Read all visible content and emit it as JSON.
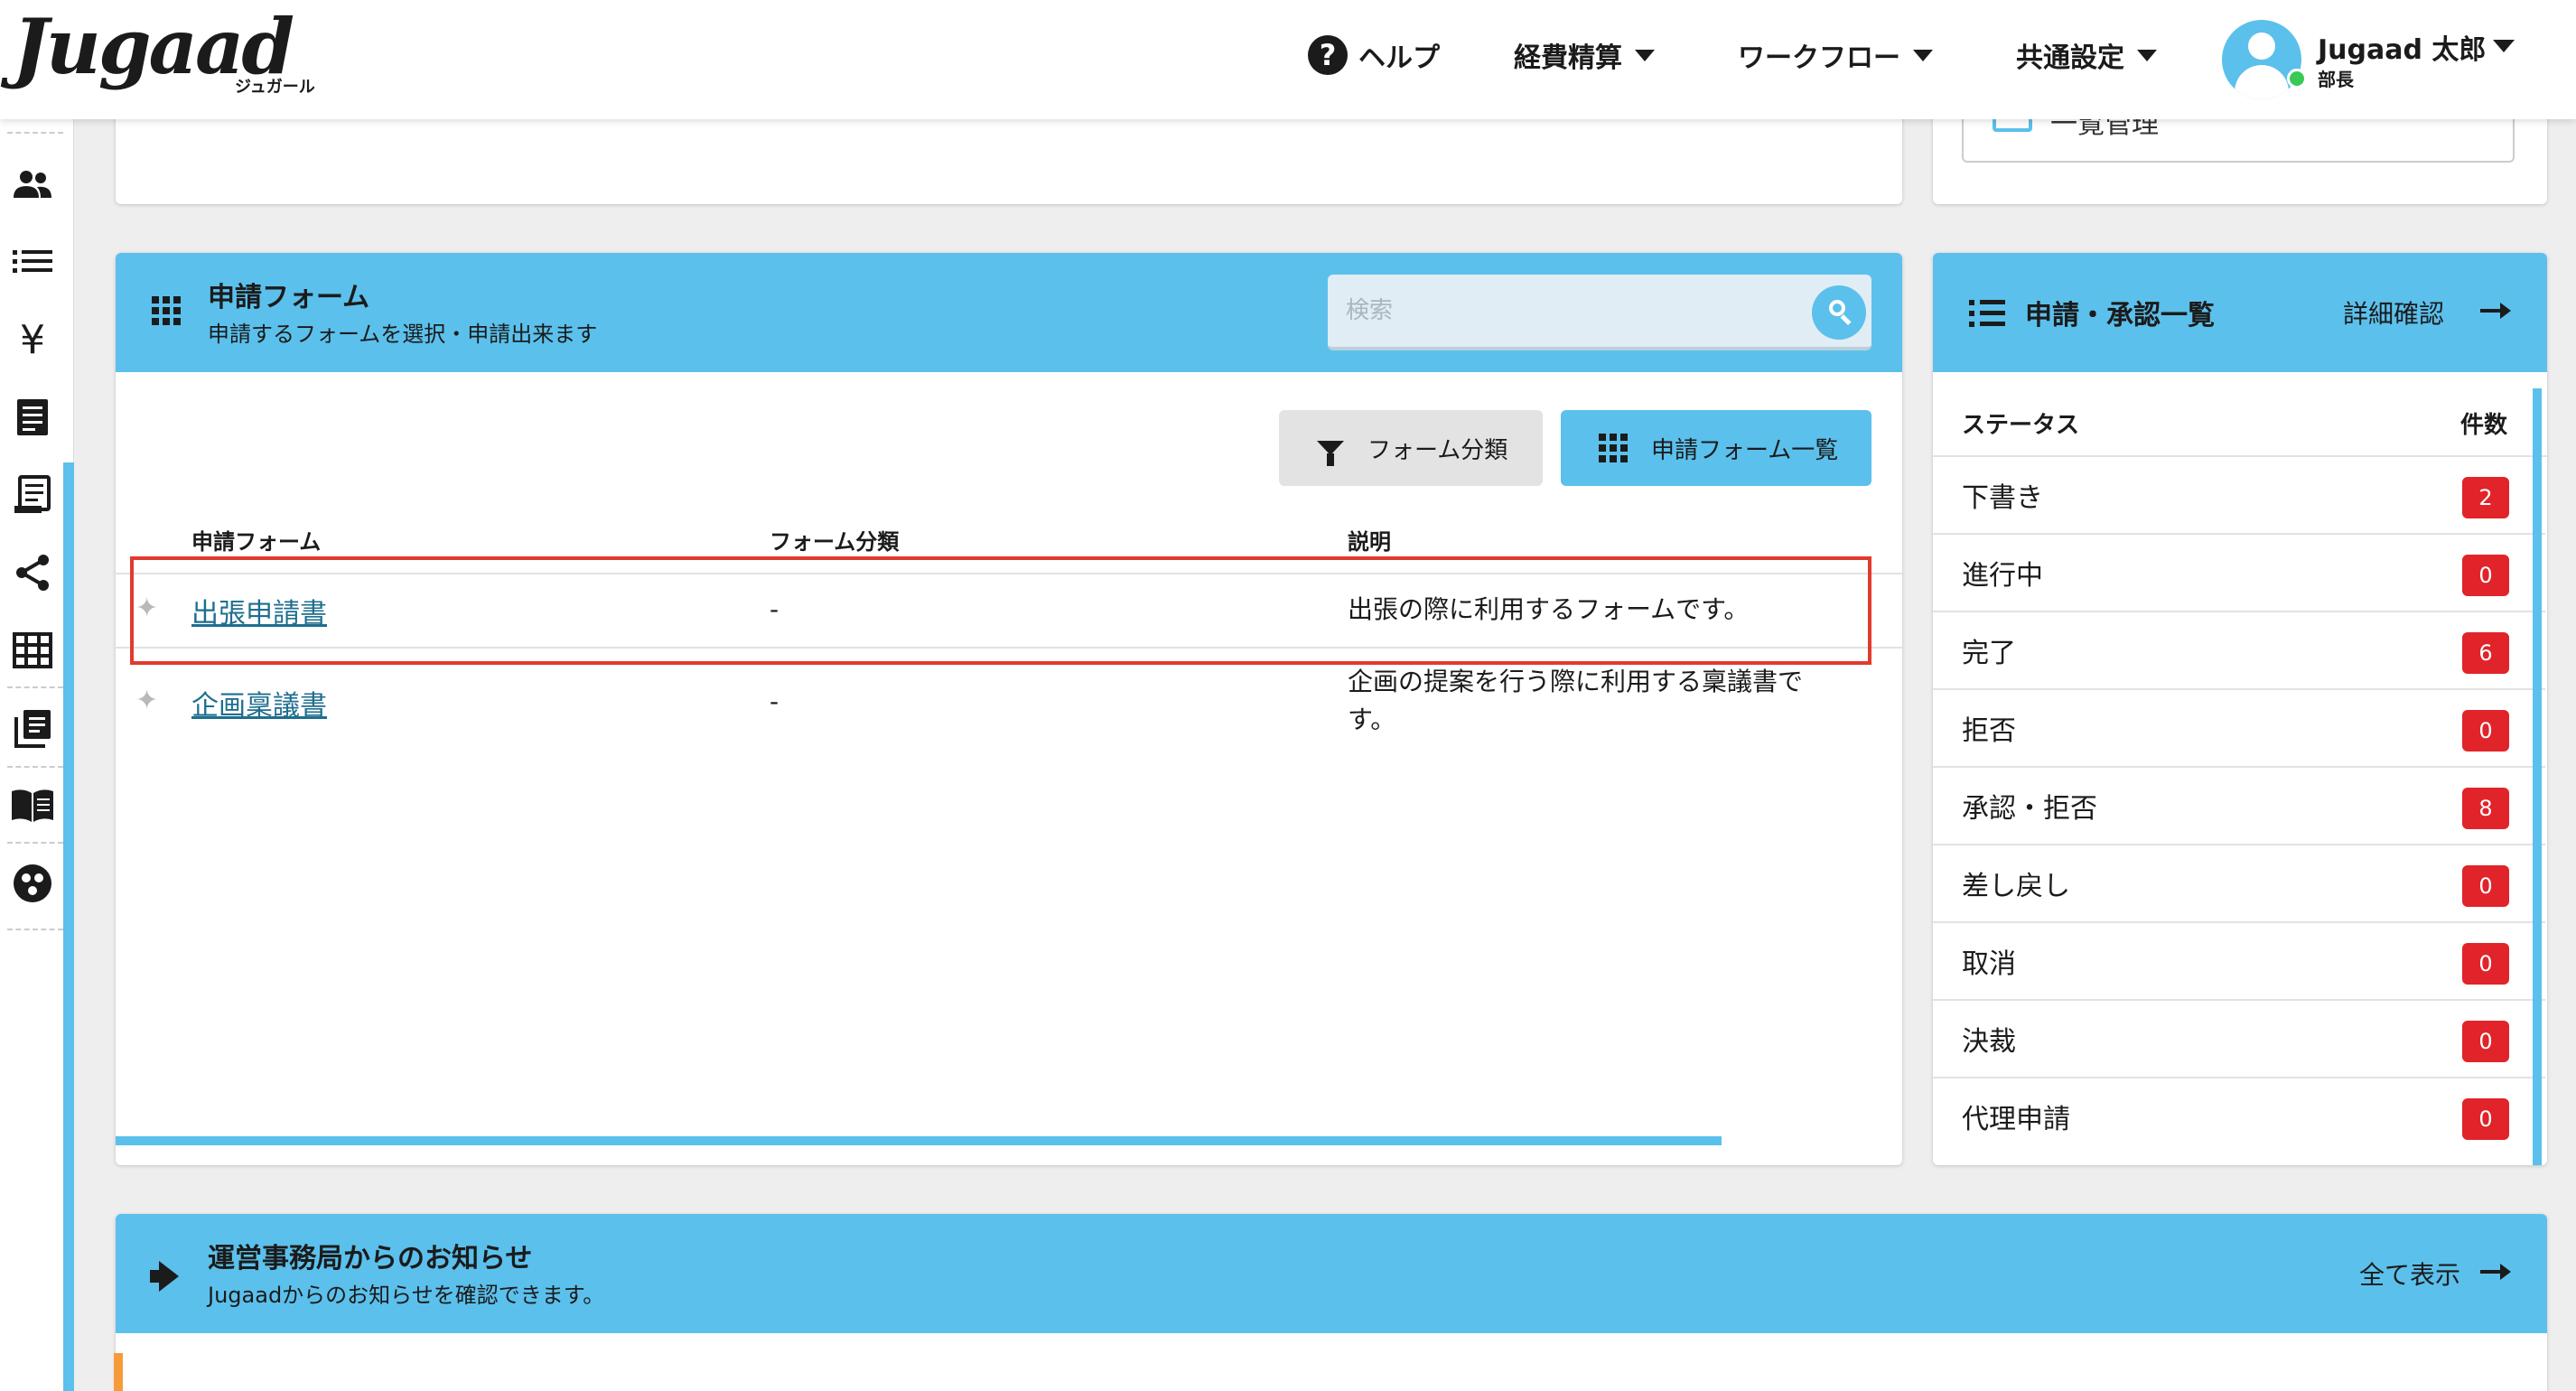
{
  "header": {
    "logo_text": "Jugaad",
    "logo_sub": "ジュガール",
    "nav": {
      "help": "ヘルプ",
      "expense": "経費精算",
      "workflow": "ワークフロー",
      "common": "共通設定"
    },
    "user": {
      "name": "Jugaad 太郎",
      "role": "部長"
    }
  },
  "top_card": {
    "list_manage_label": "一覧管理"
  },
  "form_card": {
    "title": "申請フォーム",
    "subtitle": "申請するフォームを選択・申請出来ます",
    "search_placeholder": "検索",
    "buttons": {
      "category": "フォーム分類",
      "list": "申請フォーム一覧"
    },
    "columns": {
      "form": "申請フォーム",
      "category": "フォーム分類",
      "description": "説明"
    },
    "rows": [
      {
        "name": "出張申請書",
        "category": "-",
        "description": "出張の際に利用するフォームです。"
      },
      {
        "name": "企画稟議書",
        "category": "-",
        "description_line1": "企画の提案を行う際に利用する稟議書で",
        "description_line2": "す。"
      }
    ]
  },
  "status_card": {
    "title": "申請・承認一覧",
    "detail_link": "詳細確認",
    "columns": {
      "status": "ステータス",
      "count": "件数"
    },
    "rows": [
      {
        "label": "下書き",
        "count": "2"
      },
      {
        "label": "進行中",
        "count": "0"
      },
      {
        "label": "完了",
        "count": "6"
      },
      {
        "label": "拒否",
        "count": "0"
      },
      {
        "label": "承認・拒否",
        "count": "8"
      },
      {
        "label": "差し戻し",
        "count": "0"
      },
      {
        "label": "取消",
        "count": "0"
      },
      {
        "label": "決裁",
        "count": "0"
      },
      {
        "label": "代理申請",
        "count": "0"
      }
    ]
  },
  "news_card": {
    "title": "運営事務局からのお知らせ",
    "subtitle": "Jugaadからのお知らせを確認できます。",
    "show_all": "全て表示"
  },
  "colors": {
    "accent": "#5bc0ec",
    "badge": "#e0242a",
    "link": "#1f6e8f",
    "highlight": "#e23a2c"
  }
}
